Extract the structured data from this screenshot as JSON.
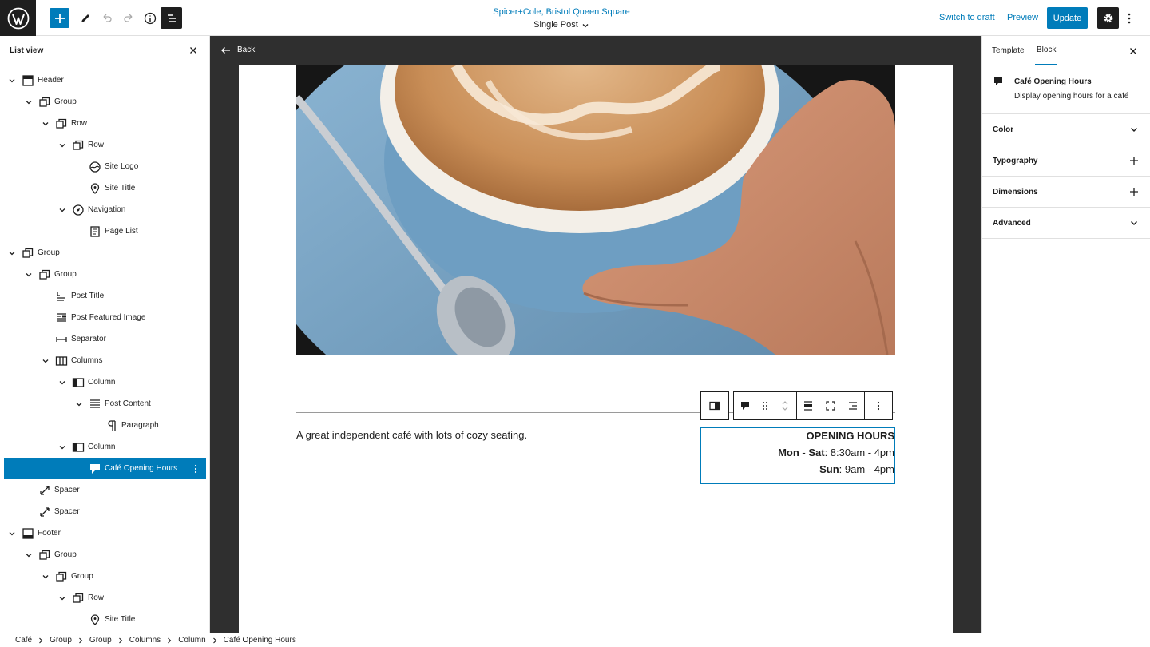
{
  "header": {
    "site_name": "Spicer+Cole, Bristol Queen Square",
    "template_name": "Single Post",
    "switch_to_draft": "Switch to draft",
    "preview": "Preview",
    "update": "Update"
  },
  "list_view": {
    "title": "List view",
    "items": [
      {
        "label": "Header",
        "icon": "template-part-icon",
        "expanded": true
      },
      {
        "label": "Group",
        "icon": "group-icon",
        "expanded": true
      },
      {
        "label": "Row",
        "icon": "row-icon",
        "expanded": true
      },
      {
        "label": "Row",
        "icon": "row-icon",
        "expanded": true
      },
      {
        "label": "Site Logo",
        "icon": "site-logo-icon"
      },
      {
        "label": "Site Title",
        "icon": "map-marker-icon"
      },
      {
        "label": "Navigation",
        "icon": "navigation-icon",
        "expanded": true
      },
      {
        "label": "Page List",
        "icon": "page-list-icon"
      },
      {
        "label": "Group",
        "icon": "group-icon",
        "expanded": true
      },
      {
        "label": "Group",
        "icon": "group-icon",
        "expanded": true
      },
      {
        "label": "Post Title",
        "icon": "post-title-icon"
      },
      {
        "label": "Post Featured Image",
        "icon": "featured-image-icon"
      },
      {
        "label": "Separator",
        "icon": "separator-icon"
      },
      {
        "label": "Columns",
        "icon": "columns-icon",
        "expanded": true
      },
      {
        "label": "Column",
        "icon": "column-icon",
        "expanded": true
      },
      {
        "label": "Post Content",
        "icon": "post-content-icon",
        "expanded": true
      },
      {
        "label": "Paragraph",
        "icon": "paragraph-icon"
      },
      {
        "label": "Column",
        "icon": "column-icon",
        "expanded": true
      },
      {
        "label": "Café Opening Hours",
        "icon": "comment-icon",
        "selected": true
      },
      {
        "label": "Spacer",
        "icon": "spacer-icon"
      },
      {
        "label": "Spacer",
        "icon": "spacer-icon"
      },
      {
        "label": "Footer",
        "icon": "footer-icon",
        "expanded": true
      },
      {
        "label": "Group",
        "icon": "group-icon",
        "expanded": true
      },
      {
        "label": "Group",
        "icon": "group-icon",
        "expanded": true
      },
      {
        "label": "Row",
        "icon": "row-icon",
        "expanded": true
      },
      {
        "label": "Site Title",
        "icon": "map-marker-icon"
      }
    ]
  },
  "canvas": {
    "back": "Back",
    "paragraph": "A great independent café with lots of cozy seating.",
    "hours": {
      "heading": "OPENING HOURS",
      "line1_bold": "Mon - Sat",
      "line1_rest": ": 8:30am - 4pm",
      "line2_bold": "Sun",
      "line2_rest": ": 9am - 4pm"
    }
  },
  "sidebar": {
    "tabs": [
      "Template",
      "Block"
    ],
    "active_tab": "Block",
    "block_title": "Café Opening Hours",
    "block_desc": "Display opening hours for a café",
    "panels": [
      {
        "label": "Color",
        "icon": "chevron-down-icon"
      },
      {
        "label": "Typography",
        "icon": "plus-icon"
      },
      {
        "label": "Dimensions",
        "icon": "plus-icon"
      },
      {
        "label": "Advanced",
        "icon": "chevron-down-icon"
      }
    ]
  },
  "breadcrumb": [
    "Café",
    "Group",
    "Group",
    "Columns",
    "Column",
    "Café Opening Hours"
  ],
  "colors": {
    "accent": "#007cba",
    "dark": "#1e1e1e",
    "canvas_bg": "#2f2f2f"
  }
}
